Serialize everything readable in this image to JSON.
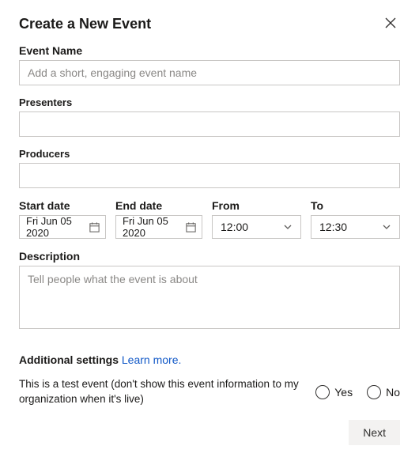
{
  "dialog": {
    "title": "Create a New Event"
  },
  "eventName": {
    "label": "Event Name",
    "placeholder": "Add a short, engaging event name"
  },
  "presenters": {
    "label": "Presenters",
    "value": ""
  },
  "producers": {
    "label": "Producers",
    "value": ""
  },
  "dates": {
    "startLabel": "Start date",
    "endLabel": "End date",
    "fromLabel": "From",
    "toLabel": "To",
    "startValue": "Fri Jun 05 2020",
    "endValue": "Fri Jun 05 2020",
    "fromValue": "12:00",
    "toValue": "12:30"
  },
  "description": {
    "label": "Description",
    "placeholder": "Tell people what the event is about"
  },
  "additional": {
    "heading": "Additional settings",
    "learn": "Learn more."
  },
  "testEvent": {
    "text": "This is a test event (don't show this event information to my organization when it's live)",
    "yes": "Yes",
    "no": "No"
  },
  "footer": {
    "next": "Next"
  }
}
